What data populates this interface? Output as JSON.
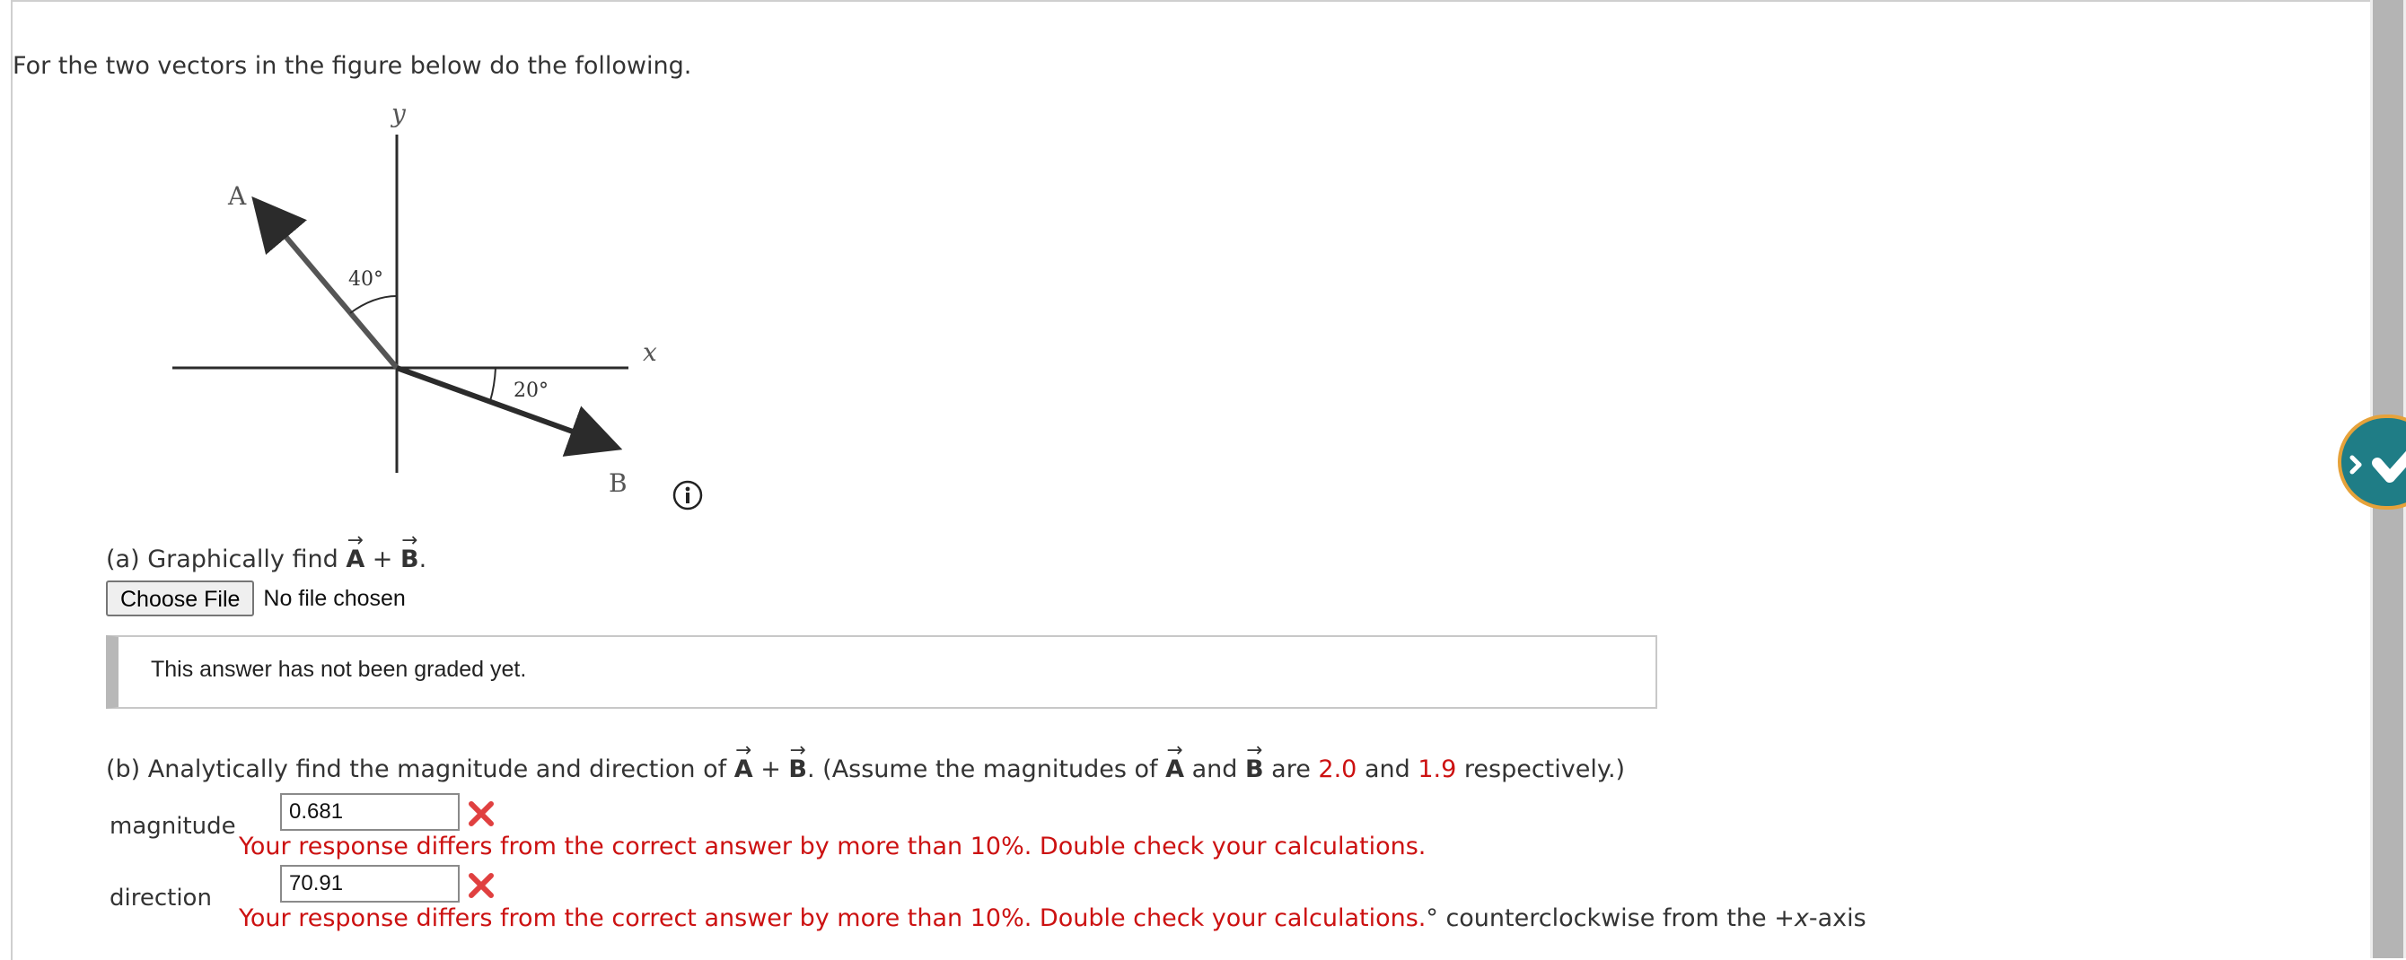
{
  "intro": "For the two vectors in the figure below do the following.",
  "figure": {
    "y_axis_label": "y",
    "x_axis_label": "x",
    "vector_a_label": "A",
    "vector_b_label": "B",
    "angle_a_label": "40°",
    "angle_b_label": "20°"
  },
  "info_icon": "info-icon",
  "part_a": {
    "prefix": "(a) Graphically find ",
    "a": "A",
    "plus": " + ",
    "b": "B",
    "suffix": ".",
    "choose_file_label": "Choose File",
    "no_file_text": "No file chosen",
    "graded_text": "This answer has not been graded yet."
  },
  "part_b": {
    "prefix": "(b) Analytically find the magnitude and direction of ",
    "a": "A",
    "plus": " + ",
    "b": "B",
    "mid": ". (Assume the magnitudes of ",
    "a2": "A",
    "and": " and ",
    "b2": "B",
    "are": " are ",
    "mag_a": "2.0",
    "and2": " and ",
    "mag_b": "1.9",
    "end": " respectively.)",
    "magnitude_label": "magnitude",
    "magnitude_value": "0.681",
    "direction_label": "direction",
    "direction_value": "70.91",
    "feedback": "Your response differs from the correct answer by more than 10%. Double check your calculations.",
    "direction_unit": "° counterclockwise from the +",
    "direction_unit_axis": "x",
    "direction_unit_end": "-axis"
  },
  "colors": {
    "error": "#cc1111",
    "widget": "#1f7d86",
    "widget_ring": "#e6a23a"
  }
}
